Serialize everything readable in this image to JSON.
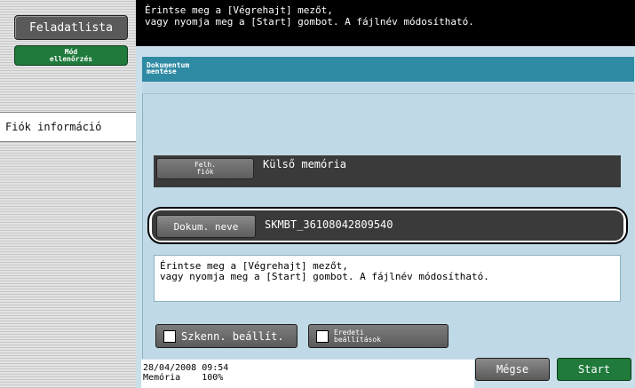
{
  "sidebar": {
    "job_list_label": "Feladatlista",
    "mode_check_line1": "Mód",
    "mode_check_line2": "ellenőrzés",
    "account_info_label": "Fiók információ"
  },
  "message_bar": {
    "line1": "Érintse meg a [Végrehajt] mezőt,",
    "line2": "vagy nyomja meg a [Start] gombot. A fájlnév módosítható."
  },
  "panel": {
    "title_line1": "Dokumentum",
    "title_line2": "mentése"
  },
  "user_box": {
    "button_line1": "Felh.",
    "button_line2": "fiók",
    "value": "Külső memória"
  },
  "doc_name": {
    "button_label": "Dokum. neve",
    "value": "SKMBT_36108042809540"
  },
  "info_message": {
    "line1": "Érintse meg a [Végrehajt] mezőt,",
    "line2": "vagy nyomja meg a [Start] gombot. A fájlnév módosítható."
  },
  "bottom_buttons": {
    "scan_settings_label": "Szkenn. beállít.",
    "original_settings_line1": "Eredeti",
    "original_settings_line2": "beállítások"
  },
  "status": {
    "datetime": "28/04/2008   09:54",
    "memory_label": "Memória",
    "memory_value": "100%"
  },
  "actions": {
    "cancel_label": "Mégse",
    "start_label": "Start"
  }
}
